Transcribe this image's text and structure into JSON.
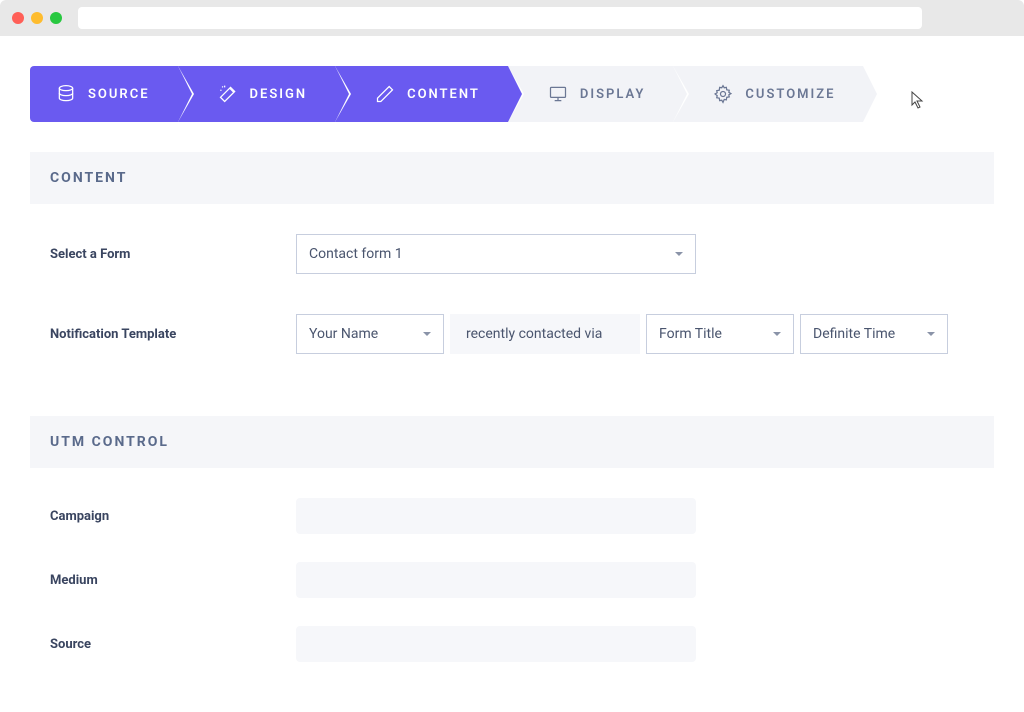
{
  "stepper": {
    "items": [
      {
        "label": "SOURCE",
        "icon": "database",
        "active": true
      },
      {
        "label": "DESIGN",
        "icon": "wand",
        "active": true
      },
      {
        "label": "CONTENT",
        "icon": "pencil",
        "active": true
      },
      {
        "label": "DISPLAY",
        "icon": "monitor",
        "active": false
      },
      {
        "label": "CUSTOMIZE",
        "icon": "gear",
        "active": false
      }
    ]
  },
  "sections": {
    "content": {
      "title": "CONTENT",
      "select_form_label": "Select a Form",
      "select_form_value": "Contact form 1",
      "notification_label": "Notification Template",
      "template": {
        "name_field": "Your Name",
        "static_text": "recently contacted via",
        "form_title": "Form Title",
        "time": "Definite Time"
      }
    },
    "utm": {
      "title": "UTM CONTROL",
      "fields": [
        {
          "label": "Campaign",
          "value": ""
        },
        {
          "label": "Medium",
          "value": ""
        },
        {
          "label": "Source",
          "value": ""
        }
      ]
    }
  }
}
